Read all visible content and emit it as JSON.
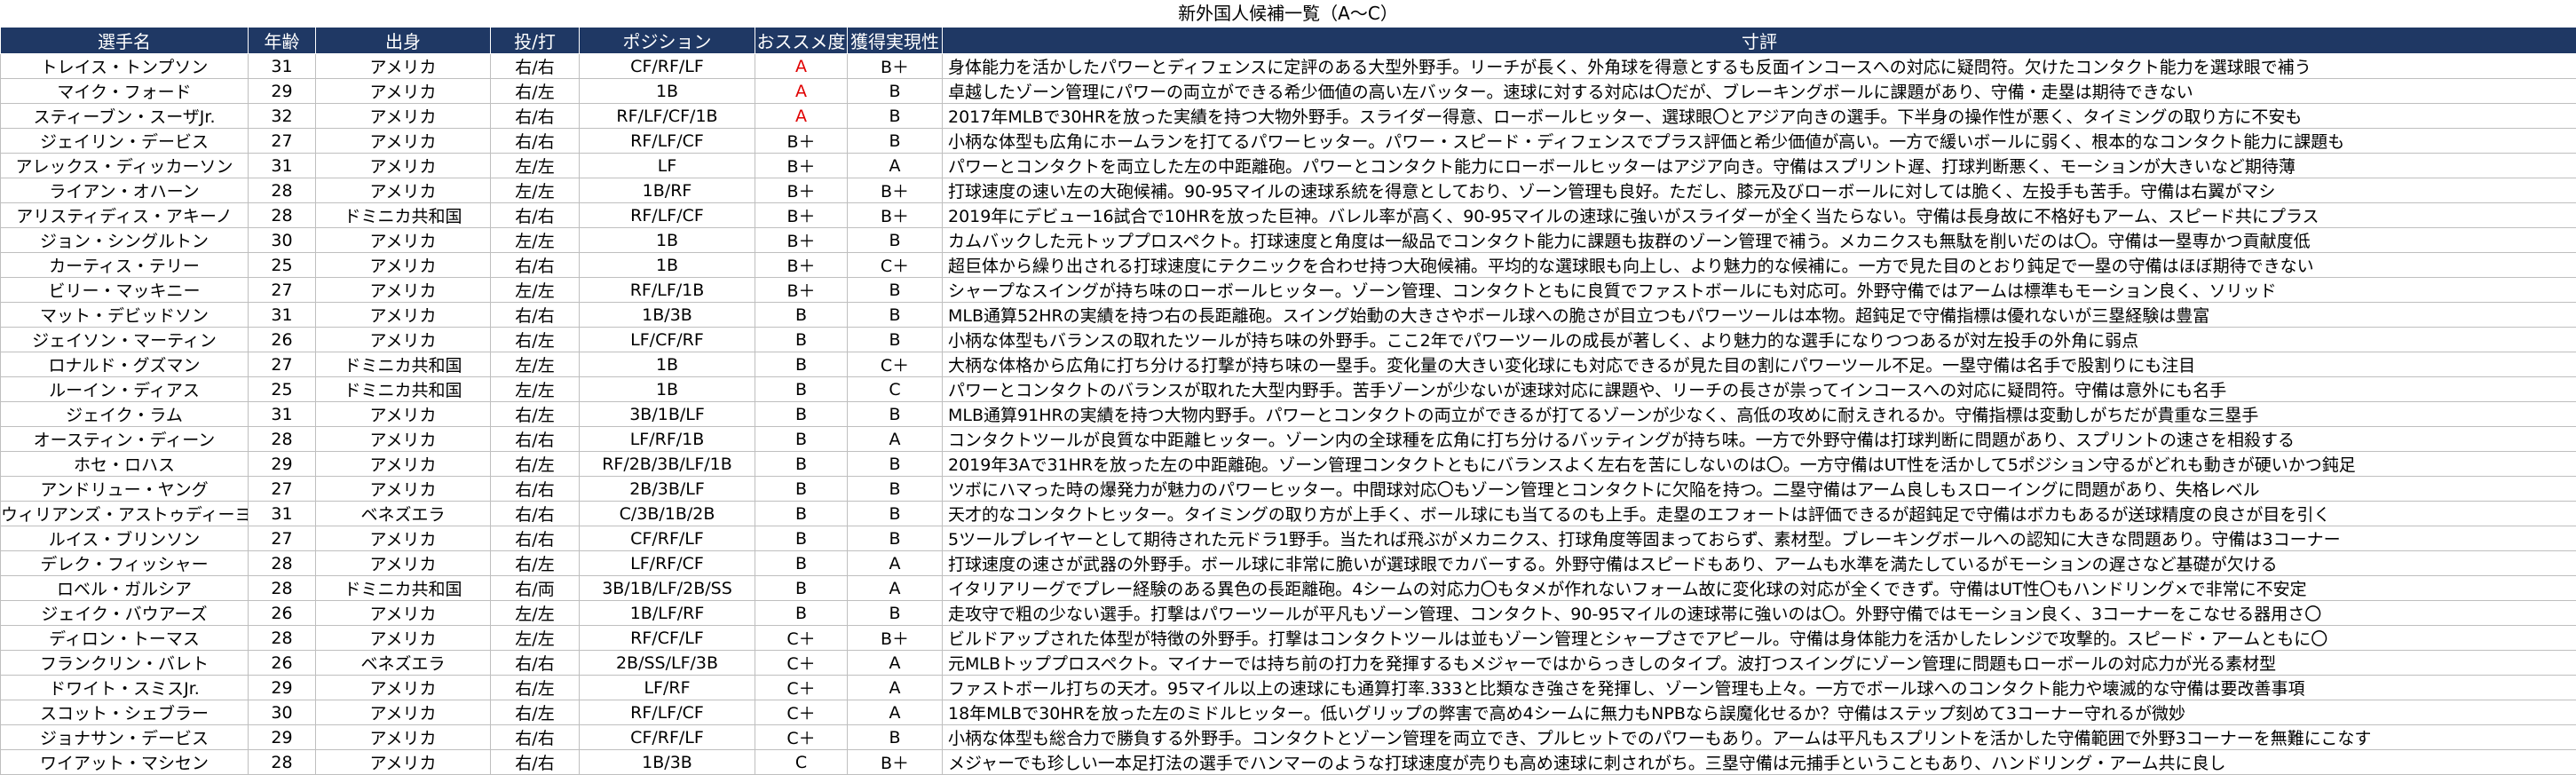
{
  "title": "新外国人候補一覧（A〜C）",
  "headers": {
    "name": "選手名",
    "age": "年齢",
    "origin": "出身",
    "throw_bat": "投/打",
    "position": "ポジション",
    "recommend": "おススメ度",
    "feasibility": "獲得実現性",
    "comment": "寸評"
  },
  "colors": {
    "header_bg": "#1f3864",
    "header_text": "#ffffff",
    "rating_a": "#e00000"
  },
  "rows": [
    {
      "name": "トレイス・トンプソン",
      "age": "31",
      "origin": "アメリカ",
      "tb": "右/右",
      "pos": "CF/RF/LF",
      "rec": "A",
      "feas": "B＋",
      "comment": "身体能力を活かしたパワーとディフェンスに定評のある大型外野手。リーチが長く、外角球を得意とするも反面インコースへの対応に疑問符。欠けたコンタクト能力を選球眼で補う"
    },
    {
      "name": "マイク・フォード",
      "age": "29",
      "origin": "アメリカ",
      "tb": "右/左",
      "pos": "1B",
      "rec": "A",
      "feas": "B",
      "comment": "卓越したゾーン管理にパワーの両立ができる希少価値の高い左バッター。速球に対する対応は〇だが、ブレーキングボールに課題があり、守備・走塁は期待できない"
    },
    {
      "name": "スティーブン・スーザJr.",
      "age": "32",
      "origin": "アメリカ",
      "tb": "右/右",
      "pos": "RF/LF/CF/1B",
      "rec": "A",
      "feas": "B",
      "comment": "2017年MLBで30HRを放った実績を持つ大物外野手。スライダー得意、ローボールヒッター、選球眼〇とアジア向きの選手。下半身の操作性が悪く、タイミングの取り方に不安も"
    },
    {
      "name": "ジェイリン・デービス",
      "age": "27",
      "origin": "アメリカ",
      "tb": "右/右",
      "pos": "RF/LF/CF",
      "rec": "B＋",
      "feas": "B",
      "comment": "小柄な体型も広角にホームランを打てるパワーヒッター。パワー・スピード・ディフェンスでプラス評価と希少価値が高い。一方で緩いボールに弱く、根本的なコンタクト能力に課題も"
    },
    {
      "name": "アレックス・ディッカーソン",
      "age": "31",
      "origin": "アメリカ",
      "tb": "左/左",
      "pos": "LF",
      "rec": "B＋",
      "feas": "A",
      "comment": "パワーとコンタクトを両立した左の中距離砲。パワーとコンタクト能力にローボールヒッターはアジア向き。守備はスプリント遅、打球判断悪く、モーションが大きいなど期待薄"
    },
    {
      "name": "ライアン・オハーン",
      "age": "28",
      "origin": "アメリカ",
      "tb": "左/左",
      "pos": "1B/RF",
      "rec": "B＋",
      "feas": "B＋",
      "comment": "打球速度の速い左の大砲候補。90-95マイルの速球系統を得意としており、ゾーン管理も良好。ただし、膝元及びローボールに対しては脆く、左投手も苦手。守備は右翼がマシ"
    },
    {
      "name": "アリスティディス・アキーノ",
      "age": "28",
      "origin": "ドミニカ共和国",
      "tb": "右/右",
      "pos": "RF/LF/CF",
      "rec": "B＋",
      "feas": "B＋",
      "comment": "2019年にデビュー16試合で10HRを放った巨神。バレル率が高く、90-95マイルの速球に強いがスライダーが全く当たらない。守備は長身故に不格好もアーム、スピード共にプラス"
    },
    {
      "name": "ジョン・シングルトン",
      "age": "30",
      "origin": "アメリカ",
      "tb": "左/左",
      "pos": "1B",
      "rec": "B＋",
      "feas": "B",
      "comment": "カムバックした元トッププロスペクト。打球速度と角度は一級品でコンタクト能力に課題も抜群のゾーン管理で補う。メカニクスも無駄を削いだのは〇。守備は一塁専かつ貢献度低"
    },
    {
      "name": "カーティス・テリー",
      "age": "25",
      "origin": "アメリカ",
      "tb": "右/右",
      "pos": "1B",
      "rec": "B＋",
      "feas": "C＋",
      "comment": "超巨体から繰り出される打球速度にテクニックを合わせ持つ大砲候補。平均的な選球眼も向上し、より魅力的な候補に。一方で見た目のとおり鈍足で一塁の守備はほぼ期待できない"
    },
    {
      "name": "ビリー・マッキニー",
      "age": "27",
      "origin": "アメリカ",
      "tb": "左/左",
      "pos": "RF/LF/1B",
      "rec": "B＋",
      "feas": "B",
      "comment": "シャープなスイングが持ち味のローボールヒッター。ゾーン管理、コンタクトともに良質でファストボールにも対応可。外野守備ではアームは標準もモーション良く、ソリッド"
    },
    {
      "name": "マット・デビッドソン",
      "age": "31",
      "origin": "アメリカ",
      "tb": "右/右",
      "pos": "1B/3B",
      "rec": "B",
      "feas": "B",
      "comment": "MLB通算52HRの実績を持つ右の長距離砲。スイング始動の大きさやボール球への脆さが目立つもパワーツールは本物。超鈍足で守備指標は優れないが三塁経験は豊富"
    },
    {
      "name": "ジェイソン・マーティン",
      "age": "26",
      "origin": "アメリカ",
      "tb": "右/左",
      "pos": "LF/CF/RF",
      "rec": "B",
      "feas": "B",
      "comment": "小柄な体型もバランスの取れたツールが持ち味の外野手。ここ2年でパワーツールの成長が著しく、より魅力的な選手になりつつあるが対左投手の外角に弱点"
    },
    {
      "name": "ロナルド・グズマン",
      "age": "27",
      "origin": "ドミニカ共和国",
      "tb": "左/左",
      "pos": "1B",
      "rec": "B",
      "feas": "C＋",
      "comment": "大柄な体格から広角に打ち分ける打撃が持ち味の一塁手。変化量の大きい変化球にも対応できるが見た目の割にパワーツール不足。一塁守備は名手で股割りにも注目"
    },
    {
      "name": "ルーイン・ディアス",
      "age": "25",
      "origin": "ドミニカ共和国",
      "tb": "左/左",
      "pos": "1B",
      "rec": "B",
      "feas": "C",
      "comment": "パワーとコンタクトのバランスが取れた大型内野手。苦手ゾーンが少ないが速球対応に課題や、リーチの長さが祟ってインコースへの対応に疑問符。守備は意外にも名手"
    },
    {
      "name": "ジェイク・ラム",
      "age": "31",
      "origin": "アメリカ",
      "tb": "右/左",
      "pos": "3B/1B/LF",
      "rec": "B",
      "feas": "B",
      "comment": "MLB通算91HRの実績を持つ大物内野手。パワーとコンタクトの両立ができるが打てるゾーンが少なく、高低の攻めに耐えきれるか。守備指標は変動しがちだが貴重な三塁手"
    },
    {
      "name": "オースティン・ディーン",
      "age": "28",
      "origin": "アメリカ",
      "tb": "右/右",
      "pos": "LF/RF/1B",
      "rec": "B",
      "feas": "A",
      "comment": "コンタクトツールが良質な中距離ヒッター。ゾーン内の全球種を広角に打ち分けるバッティングが持ち味。一方で外野守備は打球判断に問題があり、スプリントの速さを相殺する"
    },
    {
      "name": "ホセ・ロハス",
      "age": "29",
      "origin": "アメリカ",
      "tb": "右/左",
      "pos": "RF/2B/3B/LF/1B",
      "rec": "B",
      "feas": "B",
      "comment": "2019年3Aで31HRを放った左の中距離砲。ゾーン管理コンタクトともにバランスよく左右を苦にしないのは〇。一方守備はUT性を活かして5ポジション守るがどれも動きが硬いかつ鈍足"
    },
    {
      "name": "アンドリュー・ヤング",
      "age": "27",
      "origin": "アメリカ",
      "tb": "右/右",
      "pos": "2B/3B/LF",
      "rec": "B",
      "feas": "B",
      "comment": "ツボにハマった時の爆発力が魅力のパワーヒッター。中間球対応〇もゾーン管理とコンタクトに欠陥を持つ。二塁守備はアーム良しもスローイングに問題があり、失格レベル"
    },
    {
      "name": "ウィリアンズ・アストゥディーヨ",
      "age": "31",
      "origin": "ベネズエラ",
      "tb": "右/右",
      "pos": "C/3B/1B/2B",
      "rec": "B",
      "feas": "B",
      "comment": "天才的なコンタクトヒッター。タイミングの取り方が上手く、ボール球にも当てるのも上手。走塁のエフォートは評価できるが超鈍足で守備はボカもあるが送球精度の良さが目を引く"
    },
    {
      "name": "ルイス・ブリンソン",
      "age": "27",
      "origin": "アメリカ",
      "tb": "右/右",
      "pos": "CF/RF/LF",
      "rec": "B",
      "feas": "B",
      "comment": "5ツールプレイヤーとして期待された元ドラ1野手。当たれば飛ぶがメカニクス、打球角度等固まっておらず、素材型。ブレーキングボールへの認知に大きな問題あり。守備は3コーナー"
    },
    {
      "name": "デレク・フィッシャー",
      "age": "28",
      "origin": "アメリカ",
      "tb": "右/左",
      "pos": "LF/RF/CF",
      "rec": "B",
      "feas": "A",
      "comment": "打球速度の速さが武器の外野手。ボール球に非常に脆いが選球眼でカバーする。外野守備はスピードもあり、アームも水準を満たしているがモーションの遅さなど基礎が欠ける"
    },
    {
      "name": "ロベル・ガルシア",
      "age": "28",
      "origin": "ドミニカ共和国",
      "tb": "右/両",
      "pos": "3B/1B/LF/2B/SS",
      "rec": "B",
      "feas": "A",
      "comment": "イタリアリーグでプレー経験のある異色の長距離砲。4シームの対応力〇もタメが作れないフォーム故に変化球の対応が全くできず。守備はUT性〇もハンドリング×で非常に不安定"
    },
    {
      "name": "ジェイク・バウアーズ",
      "age": "26",
      "origin": "アメリカ",
      "tb": "左/左",
      "pos": "1B/LF/RF",
      "rec": "B",
      "feas": "B",
      "comment": "走攻守で粗の少ない選手。打撃はパワーツールが平凡もゾーン管理、コンタクト、90-95マイルの速球帯に強いのは〇。外野守備ではモーション良く、3コーナーをこなせる器用さ〇"
    },
    {
      "name": "ディロン・トーマス",
      "age": "28",
      "origin": "アメリカ",
      "tb": "左/左",
      "pos": "RF/CF/LF",
      "rec": "C＋",
      "feas": "B＋",
      "comment": "ビルドアップされた体型が特徴の外野手。打撃はコンタクトツールは並もゾーン管理とシャープさでアピール。守備は身体能力を活かしたレンジで攻撃的。スピード・アームともに〇"
    },
    {
      "name": "フランクリン・バレト",
      "age": "26",
      "origin": "ベネズエラ",
      "tb": "右/右",
      "pos": "2B/SS/LF/3B",
      "rec": "C＋",
      "feas": "A",
      "comment": "元MLBトッププロスペクト。マイナーでは持ち前の打力を発揮するもメジャーではからっきしのタイプ。波打つスイングにゾーン管理に問題もローボールの対応力が光る素材型"
    },
    {
      "name": "ドワイト・スミスJr.",
      "age": "29",
      "origin": "アメリカ",
      "tb": "右/左",
      "pos": "LF/RF",
      "rec": "C＋",
      "feas": "A",
      "comment": "ファストボール打ちの天才。95マイル以上の速球にも通算打率.333と比類なき強さを発揮し、ゾーン管理も上々。一方でボール球へのコンタクト能力や壊滅的な守備は要改善事項"
    },
    {
      "name": "スコット・シェブラー",
      "age": "30",
      "origin": "アメリカ",
      "tb": "右/左",
      "pos": "RF/LF/CF",
      "rec": "C＋",
      "feas": "A",
      "comment": "18年MLBで30HRを放った左のミドルヒッター。低いグリップの弊害で高め4シームに無力もNPBなら誤魔化せるか？守備はステップ刻めて3コーナー守れるが微妙"
    },
    {
      "name": "ジョナサン・デービス",
      "age": "29",
      "origin": "アメリカ",
      "tb": "右/右",
      "pos": "CF/RF/LF",
      "rec": "C＋",
      "feas": "B",
      "comment": "小柄な体型も総合力で勝負する外野手。コンタクトとゾーン管理を両立でき、プルヒットでのパワーもあり。アームは平凡もスプリントを活かした守備範囲で外野3コーナーを無難にこなす"
    },
    {
      "name": "ワイアット・マシセン",
      "age": "28",
      "origin": "アメリカ",
      "tb": "右/右",
      "pos": "1B/3B",
      "rec": "C",
      "feas": "B＋",
      "comment": "メジャーでも珍しい一本足打法の選手でハンマーのような打球速度が売りも高め速球に刺されがち。三塁守備は元捕手ということもあり、ハンドリング・アーム共に良し"
    }
  ]
}
